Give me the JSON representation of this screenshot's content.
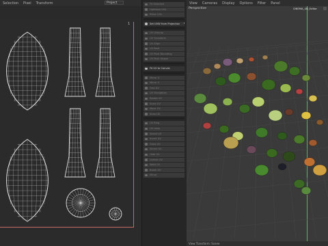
{
  "uv_editor": {
    "menu": [
      "Selection",
      "Pixel",
      "Transform"
    ],
    "project_select": "Project",
    "corner_label": "1"
  },
  "tools": {
    "items": [
      {
        "label": "Fit Selected",
        "hi": false
      },
      {
        "label": "Optimize UVs",
        "hi": false
      },
      {
        "label": "Relax UVs",
        "hi": false
      },
      {
        "label": "Set UVW from Projection",
        "hi": true
      },
      {
        "label": "UV Unwrap",
        "hi": false
      },
      {
        "label": "UV Transform",
        "hi": false
      },
      {
        "label": "UV Align",
        "hi": false
      },
      {
        "label": "UV Pack",
        "hi": false
      },
      {
        "label": "UV Pack Bounding",
        "hi": false
      },
      {
        "label": "UV Pack Shape",
        "hi": false
      },
      {
        "label": "Fit UV to Canvas",
        "hi": true
      },
      {
        "label": "Mirror U",
        "hi": false
      },
      {
        "label": "Mirror V",
        "hi": false
      },
      {
        "label": "Grid UV",
        "hi": false
      },
      {
        "label": "UV Straighten",
        "hi": false
      },
      {
        "label": "Rotate UV",
        "hi": false
      },
      {
        "label": "Scale UV",
        "hi": false
      },
      {
        "label": "Move UV",
        "hi": false
      },
      {
        "label": "Snap UV",
        "hi": false
      },
      {
        "label": "UV Ring",
        "hi": false
      },
      {
        "label": "UV Loop",
        "hi": false
      },
      {
        "label": "Select UV",
        "hi": false
      },
      {
        "label": "Invert UV",
        "hi": false
      },
      {
        "label": "Grow UV",
        "hi": false
      },
      {
        "label": "Shrink UV",
        "hi": false
      },
      {
        "label": "Hide UV",
        "hi": false
      },
      {
        "label": "Unhide UV",
        "hi": false
      },
      {
        "label": "Weld UV",
        "hi": false
      },
      {
        "label": "Break UV",
        "hi": false
      },
      {
        "label": "Mirror",
        "hi": false
      }
    ]
  },
  "viewport": {
    "menu": [
      "View",
      "Cameras",
      "Display",
      "Options",
      "Filter",
      "Panel"
    ],
    "label": "Perspective",
    "tool_hint": "CINEMA_4D_Editor",
    "status": "View Transform: Scene"
  },
  "colors": {
    "bg": "#262626",
    "uv_bg": "#2b2b2b",
    "viewport_bg": "#3a3a3a",
    "wire": "#e6e6e6",
    "accent": "#5fd46d"
  }
}
